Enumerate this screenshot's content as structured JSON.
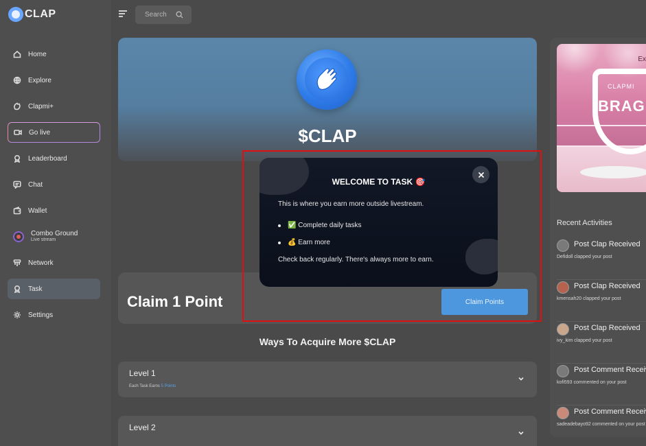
{
  "app": {
    "logo_text": "CLAP"
  },
  "search": {
    "placeholder": "Search"
  },
  "sidebar": {
    "items": [
      {
        "label": "Home",
        "icon": "home-icon"
      },
      {
        "label": "Explore",
        "icon": "globe-icon"
      },
      {
        "label": "Clapmi+",
        "icon": "clap-icon"
      },
      {
        "label": "Go live",
        "icon": "video-icon"
      },
      {
        "label": "Leaderboard",
        "icon": "trophy-icon"
      },
      {
        "label": "Chat",
        "icon": "chat-icon"
      },
      {
        "label": "Wallet",
        "icon": "wallet-icon"
      },
      {
        "label": "Combo Ground",
        "sub": "Live stream",
        "icon": "combo-icon"
      },
      {
        "label": "Network",
        "icon": "network-icon"
      },
      {
        "label": "Task",
        "icon": "task-icon"
      },
      {
        "label": "Settings",
        "icon": "gear-icon"
      }
    ]
  },
  "hero": {
    "title": "$CLAP"
  },
  "claim": {
    "title": "Claim 1 Point",
    "button_label": "Claim Points"
  },
  "ways": {
    "title": "Ways To Acquire More $CLAP"
  },
  "levels": [
    {
      "title": "Level 1",
      "sub_prefix": "Each Task Earns ",
      "points": "5 Points"
    },
    {
      "title": "Level 2"
    }
  ],
  "modal": {
    "title": "WELCOME TO TASK 🎯",
    "description": "This is where you earn more outside livestream.",
    "items": [
      "✅ Complete daily tasks",
      "💰 Earn more"
    ],
    "footer": "Check back regularly. There's always more to earn."
  },
  "promo": {
    "corner_text": "Ex",
    "brand": "CLAPMI",
    "headline": "BRAG"
  },
  "recent": {
    "title": "Recent Activities",
    "activities": [
      {
        "title": "Post Clap Received",
        "sub": "Defidoll clapped your post"
      },
      {
        "title": "Post Clap Received",
        "sub": "kmensah20 clapped your post"
      },
      {
        "title": "Post Clap Received",
        "sub": "ivy_kim clapped your post"
      },
      {
        "title": "Post Comment Received",
        "sub": "kofi593 commented on your post"
      },
      {
        "title": "Post Comment Received",
        "sub": "sadeadebayo92 commented on your post"
      }
    ]
  },
  "colors": {
    "accent": "#4d97de",
    "highlight": "#e01010",
    "modal_bg": "#0a0f1b"
  }
}
